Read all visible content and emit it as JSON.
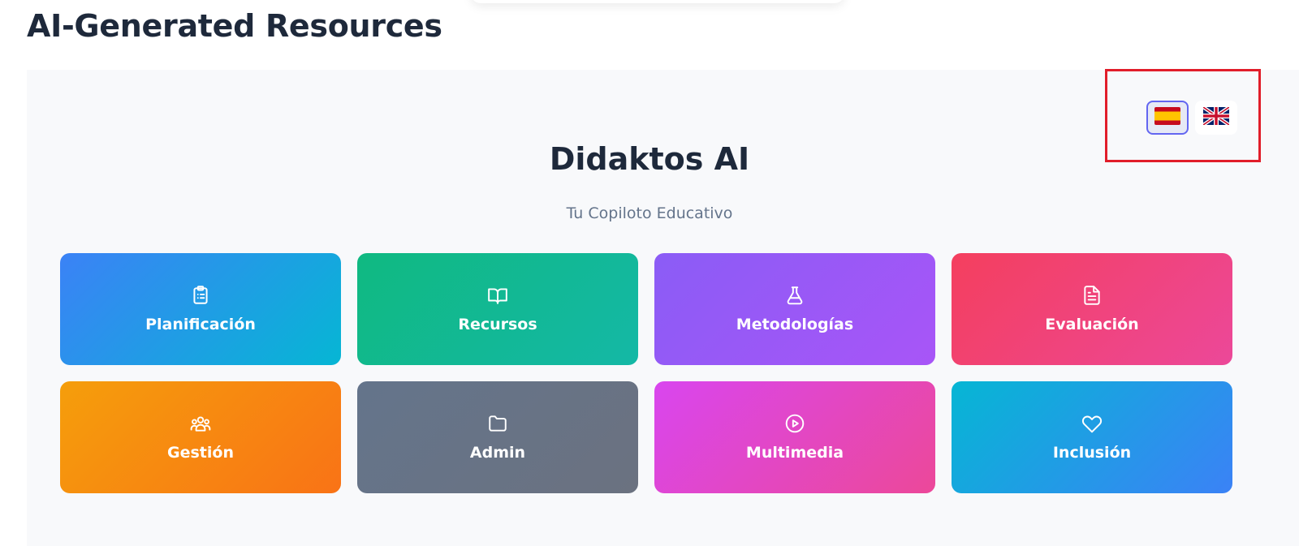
{
  "page": {
    "title": "AI-Generated Resources"
  },
  "app": {
    "brand": "Didaktos AI",
    "tagline": "Tu Copiloto Educativo"
  },
  "languages": [
    {
      "code": "es",
      "flag_icon": "spain-flag-icon",
      "active": true
    },
    {
      "code": "en",
      "flag_icon": "uk-flag-icon",
      "active": false
    }
  ],
  "tiles": [
    {
      "label": "Planificación",
      "icon": "clipboard-list-icon",
      "gradient": [
        "#3b82f6",
        "#06b6d4"
      ]
    },
    {
      "label": "Recursos",
      "icon": "open-book-icon",
      "gradient": [
        "#10b981",
        "#14b8a6"
      ]
    },
    {
      "label": "Metodologías",
      "icon": "flask-icon",
      "gradient": [
        "#8b5cf6",
        "#a855f7"
      ]
    },
    {
      "label": "Evaluación",
      "icon": "file-text-icon",
      "gradient": [
        "#f43f5e",
        "#ec4899"
      ]
    },
    {
      "label": "Gestión",
      "icon": "users-icon",
      "gradient": [
        "#f59e0b",
        "#f97316"
      ]
    },
    {
      "label": "Admin",
      "icon": "folder-icon",
      "gradient": [
        "#64748b",
        "#6b7280"
      ]
    },
    {
      "label": "Multimedia",
      "icon": "play-circle-icon",
      "gradient": [
        "#d946ef",
        "#ec4899"
      ]
    },
    {
      "label": "Inclusión",
      "icon": "heart-icon",
      "gradient": [
        "#06b6d4",
        "#3b82f6"
      ]
    }
  ],
  "colors": {
    "accent": "#6366f1",
    "highlight": "#e11d2a",
    "panel_bg": "#f8f9fb",
    "text": "#1e293b",
    "muted": "#64748b"
  }
}
